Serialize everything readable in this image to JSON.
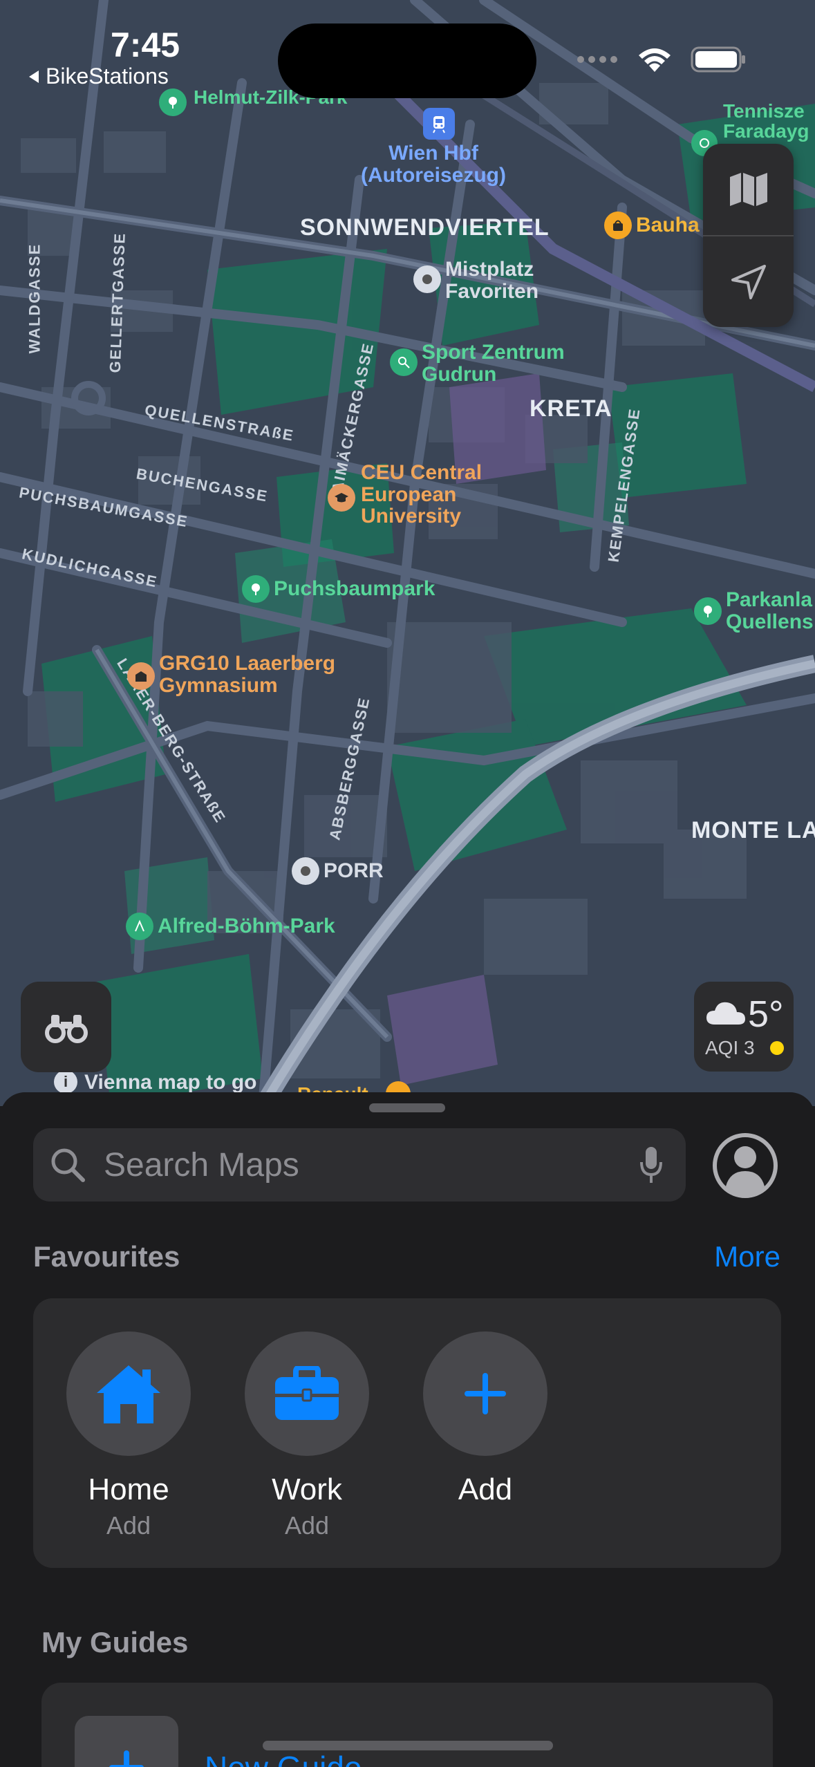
{
  "status_bar": {
    "time": "7:45",
    "back_app": "BikeStations"
  },
  "map": {
    "districts": [
      "SONNWENDVIERTEL",
      "KRETA",
      "MONTE LAA"
    ],
    "streets": [
      "WALDGASSE",
      "GELLERTGASSE",
      "QUELLENSTRAßE",
      "BUCHENGASSE",
      "PUCHSBAUMGASSE",
      "KUDLICHGASSE",
      "LAAER-BERG-STRAßE",
      "LAIMÄCKERGASSE",
      "KEMPELENGASSE",
      "ABSBERGGASSE"
    ],
    "pois": {
      "helmut_zilk_park": "Helmut-Zilk-Park",
      "wien_hbf": "Wien Hbf\n(Autoreisezug)",
      "bauhaus": "Bauha",
      "tennis": "Tennisze\nFaradayg",
      "mistplatz": "Mistplatz\nFavoriten",
      "sport_zentrum": "Sport Zentrum\nGudrun",
      "ceu": "CEU Central\nEuropean\nUniversity",
      "puchsbaumpark": "Puchsbaumpark",
      "parkanlage": "Parkanla\nQuellens",
      "grg10": "GRG10 Laaerberg\nGymnasium",
      "porr": "PORR",
      "alfred_boehm_park": "Alfred-Böhm-Park",
      "vienna_map": "Vienna map to go",
      "renault": "Renault"
    }
  },
  "weather": {
    "temperature": "5°",
    "aqi": "AQI 3",
    "aqi_color": "#ffd60a"
  },
  "sheet": {
    "search_placeholder": "Search Maps",
    "favourites_title": "Favourites",
    "more_label": "More",
    "favourites": [
      {
        "name": "Home",
        "sub": "Add",
        "icon": "house-icon"
      },
      {
        "name": "Work",
        "sub": "Add",
        "icon": "briefcase-icon"
      },
      {
        "name": "Add",
        "sub": "",
        "icon": "plus-icon"
      }
    ],
    "guides_title": "My Guides",
    "new_guide_label": "New Guide"
  },
  "colors": {
    "accent": "#0a84ff",
    "sheet_bg": "#1c1c1e",
    "card_bg": "#2c2c2e"
  }
}
